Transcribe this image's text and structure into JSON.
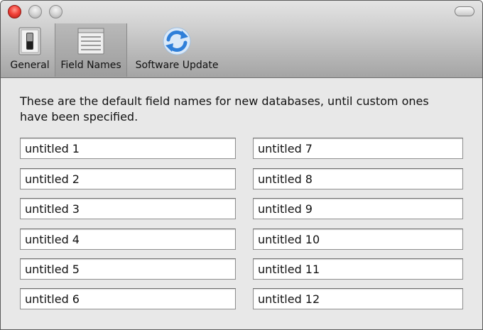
{
  "toolbar": {
    "items": [
      {
        "label": "General",
        "icon": "switch-icon"
      },
      {
        "label": "Field Names",
        "icon": "list-icon"
      },
      {
        "label": "Software Update",
        "icon": "refresh-icon"
      }
    ],
    "selected": "Field Names"
  },
  "main": {
    "description": "These are the default field names for new databases, until custom ones have been specified.",
    "fields": [
      "untitled 1",
      "untitled 2",
      "untitled 3",
      "untitled 4",
      "untitled 5",
      "untitled 6",
      "untitled 7",
      "untitled 8",
      "untitled 9",
      "untitled 10",
      "untitled 11",
      "untitled 12"
    ]
  },
  "colors": {
    "close": "#f3433a",
    "refresh": "#2f7fd9"
  }
}
